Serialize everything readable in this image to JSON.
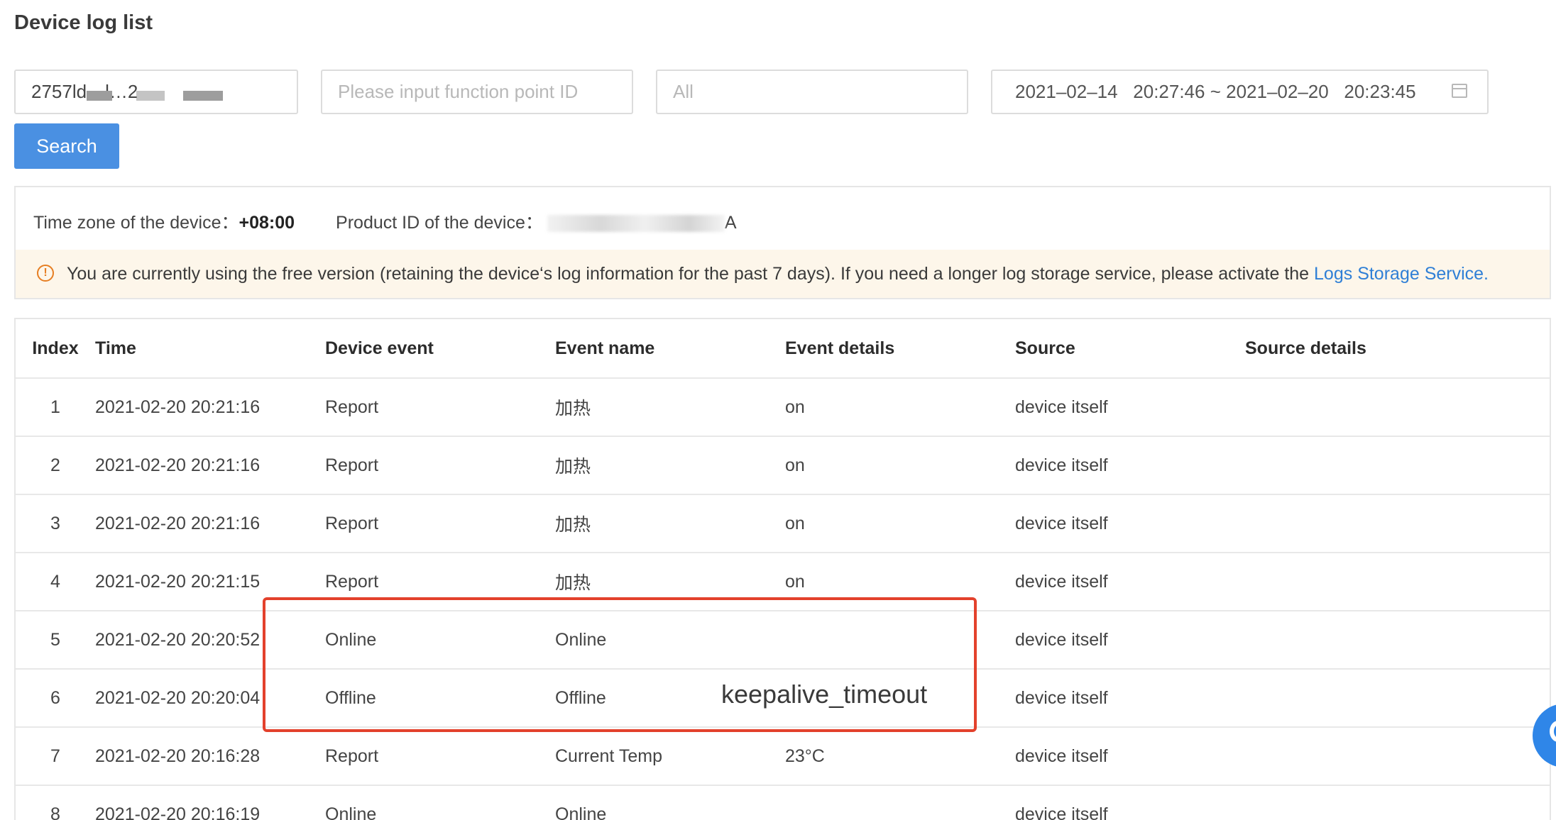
{
  "page_title": "Device log list",
  "filters": {
    "device_id_value": "2757ld…l…2",
    "function_point_placeholder": "Please input function point ID",
    "event_type_value": "All",
    "date_range": "2021–02–14   20:27:46 ~ 2021–02–20   20:23:45"
  },
  "search_label": "Search",
  "info": {
    "tz_label": "Time zone of the device：",
    "tz_value": "+08:00",
    "product_label": "Product ID of the device：",
    "product_suffix": "A",
    "notice_text": "You are currently using the free version (retaining the device‘s log information for the past 7 days). If you need a longer log storage service, please activate the ",
    "notice_link": "Logs Storage Service."
  },
  "table": {
    "headers": {
      "index": "Index",
      "time": "Time",
      "device_event": "Device event",
      "event_name": "Event name",
      "event_details": "Event details",
      "source": "Source",
      "source_details": "Source details"
    },
    "rows": [
      {
        "index": "1",
        "time": "2021-02-20 20:21:16",
        "device_event": "Report",
        "event_name": "加热",
        "event_details": "on",
        "source": "device itself",
        "source_details": ""
      },
      {
        "index": "2",
        "time": "2021-02-20 20:21:16",
        "device_event": "Report",
        "event_name": "加热",
        "event_details": "on",
        "source": "device itself",
        "source_details": ""
      },
      {
        "index": "3",
        "time": "2021-02-20 20:21:16",
        "device_event": "Report",
        "event_name": "加热",
        "event_details": "on",
        "source": "device itself",
        "source_details": ""
      },
      {
        "index": "4",
        "time": "2021-02-20 20:21:15",
        "device_event": "Report",
        "event_name": "加热",
        "event_details": "on",
        "source": "device itself",
        "source_details": ""
      },
      {
        "index": "5",
        "time": "2021-02-20 20:20:52",
        "device_event": "Online",
        "event_name": "Online",
        "event_details": "",
        "source": "device itself",
        "source_details": ""
      },
      {
        "index": "6",
        "time": "2021-02-20 20:20:04",
        "device_event": "Offline",
        "event_name": "Offline",
        "event_details": "",
        "source": "device itself",
        "source_details": ""
      },
      {
        "index": "7",
        "time": "2021-02-20 20:16:28",
        "device_event": "Report",
        "event_name": "Current Temp",
        "event_details": "23°C",
        "source": "device itself",
        "source_details": ""
      },
      {
        "index": "8",
        "time": "2021-02-20 20:16:19",
        "device_event": "Online",
        "event_name": "Online",
        "event_details": "",
        "source": "device itself",
        "source_details": ""
      }
    ]
  },
  "annotation_text": "keepalive_timeout",
  "colors": {
    "primary": "#4a90e2",
    "link": "#2f7fd6",
    "warning": "#e67e22",
    "highlight": "#e3412c",
    "notice_bg": "#fdf6ea"
  }
}
